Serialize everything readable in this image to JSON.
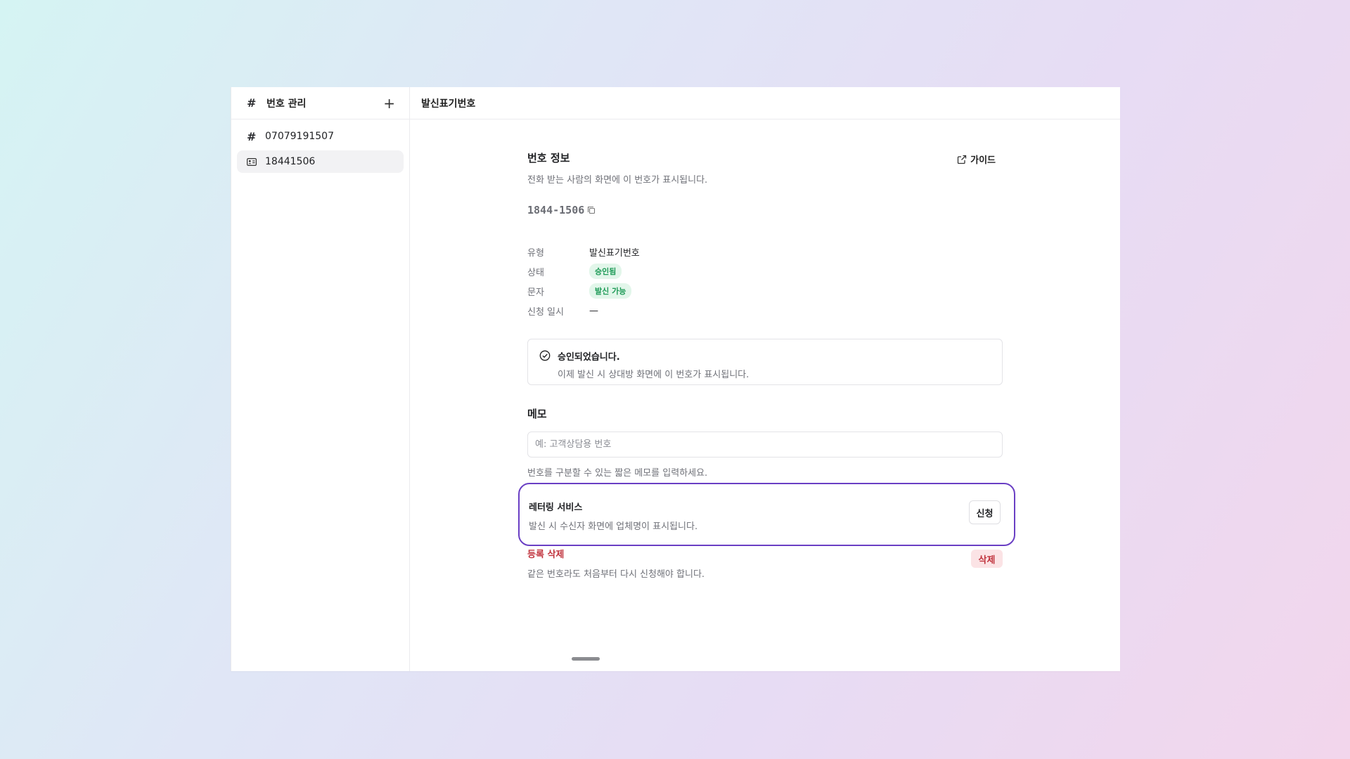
{
  "sidebar": {
    "title": "번호 관리",
    "items": [
      {
        "label": "07079191507",
        "icon": "hash-icon"
      },
      {
        "label": "18441506",
        "icon": "id-card-icon"
      }
    ]
  },
  "main": {
    "header_title": "발신표기번호",
    "section_title": "번호 정보",
    "section_subtitle": "전화 받는 사람의 화면에 이 번호가 표시됩니다.",
    "guide_label": "가이드",
    "number": "1844-1506",
    "info": {
      "type_label": "유형",
      "type_value": "발신표기번호",
      "status_label": "상태",
      "status_value": "승인됨",
      "sms_label": "문자",
      "sms_value": "발신 가능",
      "applied_label": "신청 일시",
      "applied_value": "—"
    },
    "notice": {
      "title": "승인되었습니다.",
      "subtitle": "이제 발신 시 상대방 화면에 이 번호가 표시됩니다."
    },
    "memo": {
      "title": "메모",
      "placeholder": "예: 고객상담용 번호",
      "help": "번호를 구분할 수 있는 짧은 메모를 입력하세요."
    },
    "lettering": {
      "title": "레터링 서비스",
      "subtitle": "발신 시 수신자 화면에 업체명이 표시됩니다.",
      "button": "신청"
    },
    "delete": {
      "title": "등록 삭제",
      "subtitle": "같은 번호라도 처음부터 다시 신청해야 합니다.",
      "button": "삭제"
    }
  },
  "colors": {
    "accent_outline": "#6a3fc4",
    "success": "#1d9a56",
    "danger": "#c0333d"
  }
}
